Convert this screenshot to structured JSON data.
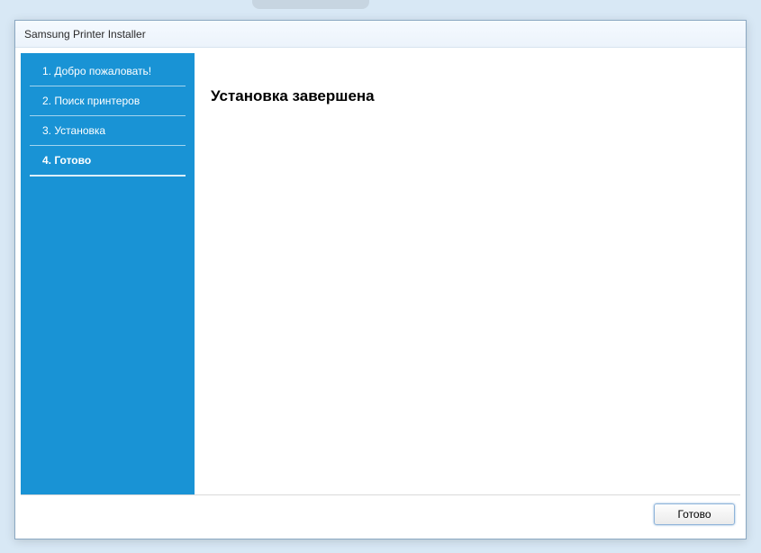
{
  "window": {
    "title": "Samsung Printer Installer"
  },
  "sidebar": {
    "steps": [
      "1. Добро пожаловать!",
      "2. Поиск принтеров",
      "3. Установка",
      "4. Готово"
    ]
  },
  "content": {
    "heading": "Установка завершена"
  },
  "footer": {
    "done_label": "Готово"
  }
}
